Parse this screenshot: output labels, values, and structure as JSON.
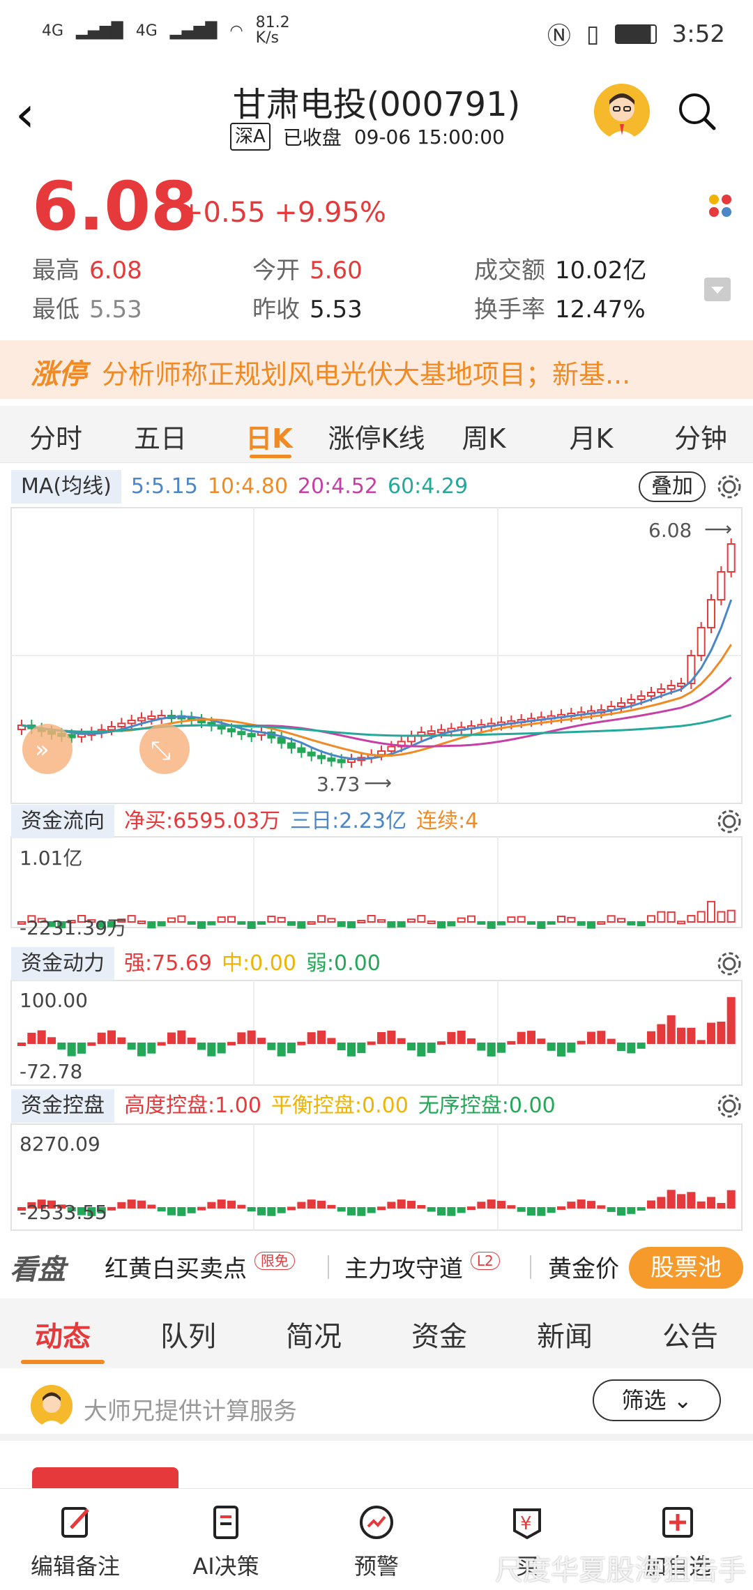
{
  "status_bar": {
    "network_1": "4G",
    "network_2": "4G",
    "speed": "81.2\nK/s",
    "time": "3:52"
  },
  "header": {
    "title": "甘肃电投(000791)",
    "market": "深A",
    "state": "已收盘",
    "datetime": "09-06 15:00:00"
  },
  "quote": {
    "price": "6.08",
    "change": "+0.55",
    "change_pct": "+9.95%",
    "high_label": "最高",
    "high": "6.08",
    "low_label": "最低",
    "low": "5.53",
    "open_label": "今开",
    "open": "5.60",
    "prev_label": "昨收",
    "prev": "5.53",
    "amount_label": "成交额",
    "amount": "10.02亿",
    "turnover_label": "换手率",
    "turnover": "12.47%"
  },
  "news": {
    "tag": "涨停",
    "text": "分析师称正规划风电光伏大基地项目；新基..."
  },
  "chart_tabs": [
    "分时",
    "五日",
    "日K",
    "涨停K线",
    "周K",
    "月K",
    "分钟"
  ],
  "chart_tabs_active": 2,
  "ma_panel": {
    "label": "MA(均线)",
    "ma5": "5:5.15",
    "ma10": "10:4.80",
    "ma20": "20:4.52",
    "ma60": "60:4.29",
    "overlay_btn": "叠加",
    "max_label": "6.08",
    "min_label": "3.73"
  },
  "flow_panel": {
    "label": "资金流向",
    "net": "净买:6595.03万",
    "three_day": "三日:2.23亿",
    "streak": "连续:4",
    "top_value": "1.01亿",
    "bottom_value": "-2231.39万"
  },
  "power_panel": {
    "label": "资金动力",
    "strong": "强:75.69",
    "mid": "中:0.00",
    "weak": "弱:0.00",
    "top_value": "100.00",
    "bottom_value": "-72.78"
  },
  "control_panel": {
    "label": "资金控盘",
    "high": "高度控盘:1.00",
    "balance": "平衡控盘:0.00",
    "disorder": "无序控盘:0.00",
    "top_value": "8270.09",
    "bottom_value": "-2533.55"
  },
  "look_strip": {
    "title": "看盘",
    "item1": "红黄白买卖点",
    "badge1": "限免",
    "item2": "主力攻守道",
    "badge2": "L2",
    "item3": "黄金价",
    "pool": "股票池"
  },
  "info_tabs": [
    "动态",
    "队列",
    "简况",
    "资金",
    "新闻",
    "公告"
  ],
  "info_tabs_active": 0,
  "service": {
    "text": "大师兄提供计算服务",
    "filter": "筛选"
  },
  "bottom_nav": [
    "编辑备注",
    "AI决策",
    "预警",
    "买",
    "加自选"
  ],
  "watermark": "尺度华夏股海狙击手",
  "colors": {
    "up": "#e5393b",
    "down": "#23a858",
    "accent": "#f08a24",
    "ma5": "#4a86c8",
    "ma10": "#f08a24",
    "ma20": "#c63fa4",
    "ma60": "#23a89a"
  }
}
